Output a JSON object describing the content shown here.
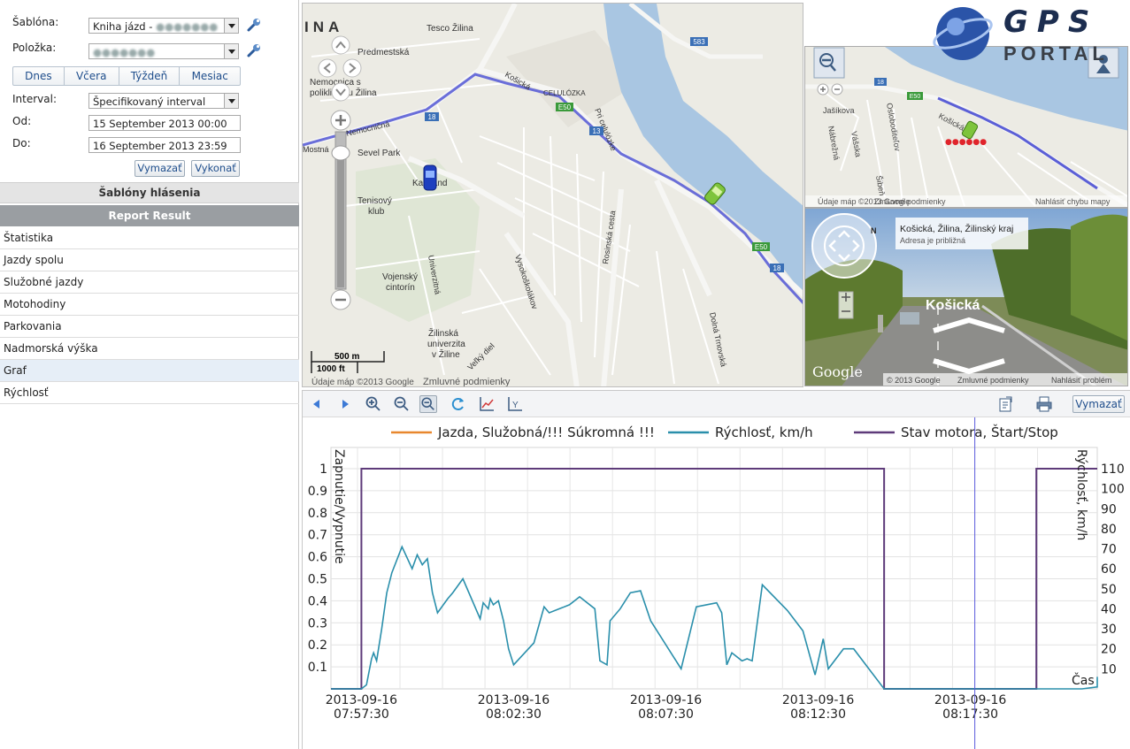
{
  "filter": {
    "sablona_label": "Šablóna:",
    "sablona_value": "Kniha jázd - ",
    "polozka_label": "Položka:",
    "quick": [
      "Dnes",
      "Včera",
      "Týždeň",
      "Mesiac"
    ],
    "interval_label": "Interval:",
    "interval_value": "Špecifikovaný interval",
    "od_label": "Od:",
    "od_value": "15 September 2013 00:00",
    "do_label": "Do:",
    "do_value": "16 September 2013 23:59",
    "vymazat": "Vymazať",
    "vykonat": "Vykonať"
  },
  "sections": {
    "templates": "Šablóny hlásenia",
    "result": "Report Result"
  },
  "reports": [
    "Štatistika",
    "Jazdy spolu",
    "Služobné jazdy",
    "Motohodiny",
    "Parkovania",
    "Nadmorská výška",
    "Graf",
    "Rýchlosť"
  ],
  "selected_report": 6,
  "map": {
    "labels": [
      "INA",
      "Tesco Žilina",
      "Predmestská",
      "Nemocnica s",
      "poliklinikou Žilina",
      "Nemocničná",
      "Mostná",
      "Sevel Park",
      "Kaufland",
      "Tenisový",
      "klub",
      "Vojenský",
      "cintorín",
      "Žilinská",
      "univerzita",
      "v Žiline",
      "Univerzitná",
      "Vysokoškolákov",
      "Rosinská cesta",
      "Košická",
      "CELULÓZKA",
      "Pri celulózke",
      "Dolná Trnovská",
      "Veľký diel"
    ],
    "road_badges": [
      "583",
      "18",
      "E50",
      "13",
      "E50",
      "18"
    ],
    "scale_m": "500 m",
    "scale_ft": "1000 ft",
    "copyright": "Údaje máp ©2013 Google",
    "terms": "Zmluvné podmienky"
  },
  "minimap": {
    "labels": [
      "Jašíkova",
      "Nábrežná",
      "Vášska",
      "Oslobodi­teľov",
      "Košická",
      "Šibeň"
    ],
    "badges": [
      "18",
      "E50"
    ],
    "footer_left": "Údaje máp ©2013 Google",
    "footer_terms": "Zmluvné podmienky",
    "footer_right": "Nahlásiť chybu mapy"
  },
  "street": {
    "address": "Košická, Žilina, Žilinský kraj",
    "note": "Adresa je približná",
    "road": "Košická",
    "compass": "N",
    "google": "Google",
    "copyright": "© 2013 Google",
    "terms": "Zmluvné podmienky",
    "report": "Nahlásiť problém"
  },
  "logo": {
    "line1": "GPS",
    "line2": "PORTAL"
  },
  "toolbar": {
    "clear": "Vymazať"
  },
  "chart_data": {
    "type": "line",
    "legend": [
      {
        "name": "Jazda, Služobná/!!! Súkromná !!!",
        "color": "#e8872e"
      },
      {
        "name": "Rýchlosť, km/h",
        "color": "#2a8fab"
      },
      {
        "name": "Stav motora, Štart/Stop",
        "color": "#5e3b7a"
      }
    ],
    "ylabel_left": "Zapnutie/Vypnutie",
    "ylabel_right": "Rýchlosť, km/h",
    "xlabel": "Čas",
    "left_ticks": [
      "0.1",
      "0.2",
      "0.3",
      "0.4",
      "0.5",
      "0.6",
      "0.7",
      "0.8",
      "0.9",
      "1"
    ],
    "right_ticks": [
      "10",
      "20",
      "30",
      "40",
      "50",
      "60",
      "70",
      "80",
      "90",
      "100",
      "110"
    ],
    "x_ticks": [
      {
        "date": "2013-09-16",
        "time": "07:57:30"
      },
      {
        "date": "2013-09-16",
        "time": "08:02:30"
      },
      {
        "date": "2013-09-16",
        "time": "08:07:30"
      },
      {
        "date": "2013-09-16",
        "time": "08:12:30"
      },
      {
        "date": "2013-09-16",
        "time": "08:17:30"
      }
    ],
    "x_range": [
      "07:56:30",
      "08:21:40"
    ],
    "y_left_range": [
      0,
      1
    ],
    "y_right_range": [
      0,
      110
    ],
    "cursor_time": "08:17:30",
    "series": [
      {
        "name": "Stav motora, Štart/Stop",
        "x": [
          "07:56:30",
          "07:57:30",
          "07:57:30",
          "08:14:40",
          "08:14:40",
          "08:19:40",
          "08:19:40",
          "08:21:40"
        ],
        "y": [
          0,
          0,
          1,
          1,
          0,
          0,
          1,
          1
        ]
      },
      {
        "name": "Rýchlosť, km/h",
        "x": [
          "07:56:30",
          "07:57:30",
          "07:57:40",
          "07:57:50",
          "07:57:54",
          "07:58:00",
          "07:58:10",
          "07:58:20",
          "07:58:30",
          "07:58:50",
          "07:59:10",
          "07:59:20",
          "07:59:30",
          "07:59:40",
          "07:59:50",
          "08:00:00",
          "08:00:20",
          "08:00:30",
          "08:00:50",
          "08:01:24",
          "08:01:30",
          "08:01:40",
          "08:01:44",
          "08:01:50",
          "08:02:00",
          "08:02:10",
          "08:02:20",
          "08:02:30",
          "08:03:10",
          "08:03:30",
          "08:03:40",
          "08:04:20",
          "08:04:40",
          "08:05:10",
          "08:05:20",
          "08:05:34",
          "08:05:40",
          "08:06:00",
          "08:06:20",
          "08:06:40",
          "08:07:00",
          "08:08:00",
          "08:08:30",
          "08:09:10",
          "08:09:20",
          "08:09:30",
          "08:09:40",
          "08:10:00",
          "08:10:10",
          "08:10:20",
          "08:10:40",
          "08:11:30",
          "08:12:00",
          "08:12:24",
          "08:12:40",
          "08:12:50",
          "08:13:20",
          "08:13:40",
          "08:14:40",
          "08:19:40",
          "08:21:10",
          "08:21:40",
          "08:22:10",
          "08:23:40"
        ],
        "y": [
          0,
          0,
          2,
          15,
          18,
          14,
          30,
          48,
          58,
          71,
          60,
          67,
          62,
          65,
          48,
          38,
          45,
          48,
          55,
          35,
          43,
          40,
          45,
          42,
          44,
          34,
          20,
          12,
          23,
          41,
          38,
          42,
          46,
          40,
          14,
          12,
          34,
          40,
          48,
          49,
          34,
          10,
          41,
          43,
          38,
          12,
          18,
          14,
          15,
          14,
          52,
          39,
          29,
          7,
          25,
          10,
          20,
          20,
          0,
          0,
          0,
          1,
          6,
          3
        ]
      },
      {
        "name": "Jazda, Služobná/!!! Súkromná !!!",
        "x": [],
        "y": []
      }
    ]
  }
}
